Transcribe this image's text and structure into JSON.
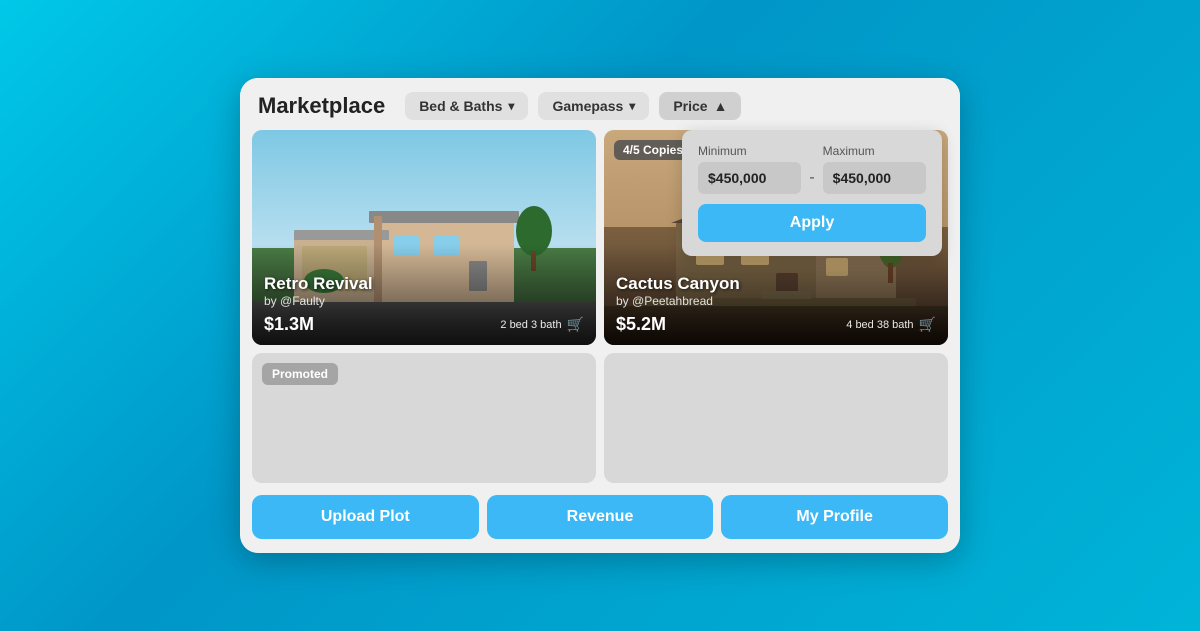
{
  "header": {
    "title": "Marketplace",
    "filters": {
      "bed_baths_label": "Bed & Baths",
      "bed_baths_chevron": "▾",
      "gamepass_label": "Gamepass",
      "gamepass_chevron": "▾",
      "price_label": "Price",
      "price_chevron": "▲"
    }
  },
  "price_dropdown": {
    "min_label": "Minimum",
    "max_label": "Maximum",
    "min_value": "$450,000",
    "max_value": "$450,000",
    "dash": "-",
    "apply_label": "Apply"
  },
  "cards": [
    {
      "id": "retro-revival",
      "title": "Retro Revival",
      "author": "by @Faulty",
      "price": "$1.3M",
      "details": "2 bed 3 bath",
      "copies": null,
      "promoted": false
    },
    {
      "id": "cactus-canyon",
      "title": "Cactus Canyon",
      "author": "by @Peetahbread",
      "price": "$5.2M",
      "details": "4 bed 38 bath",
      "copies": "4/5 Copies",
      "promoted": false
    }
  ],
  "empty_cards": [
    {
      "id": "promoted-card",
      "promoted_label": "Promoted"
    },
    {
      "id": "empty-card-2",
      "promoted_label": null
    }
  ],
  "bottom_buttons": {
    "upload_plot": "Upload Plot",
    "revenue": "Revenue",
    "my_profile": "My Profile"
  },
  "colors": {
    "accent_blue": "#3bb8f5",
    "background_gradient_start": "#00c8e8",
    "background_gradient_end": "#0096c7"
  }
}
